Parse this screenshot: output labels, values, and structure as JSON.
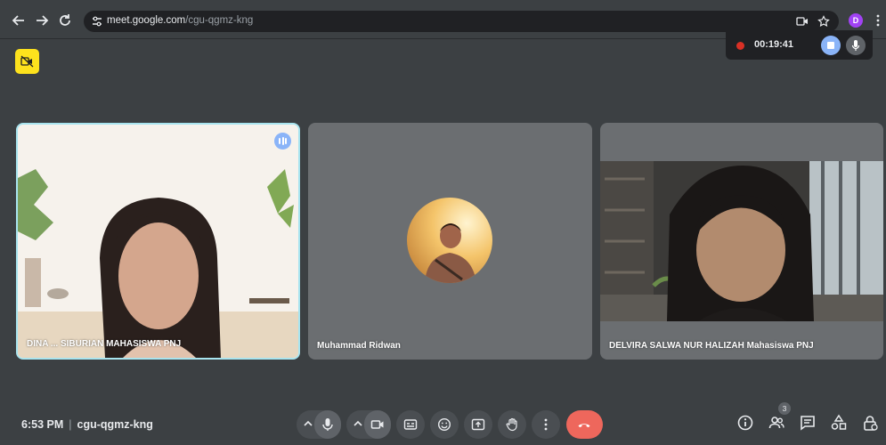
{
  "browser": {
    "url_host": "meet.google.com",
    "url_path": "/cgu-qgmz-kng",
    "profile_initial": "D"
  },
  "recorder": {
    "elapsed": "00:19:41"
  },
  "participants": [
    {
      "name": "DINA ... SIBURIAN MAHASISWA PNJ",
      "speaking": true
    },
    {
      "name": "Muhammad Ridwan",
      "camera": "off"
    },
    {
      "name": "DELVIRA SALWA NUR HALIZAH Mahasiswa PNJ",
      "camera": "on"
    }
  ],
  "bottom_bar": {
    "time": "6:53 PM",
    "meeting_code": "cgu-qgmz-kng",
    "people_count": "3"
  },
  "colors": {
    "background": "#3c4043",
    "tile": "#6b6e71",
    "end_call": "#ee675c",
    "speaking_ring": "#a8e4ef",
    "accent": "#8ab4f8",
    "yellow_badge": "#fde21d"
  },
  "icons": {
    "controls": [
      "mic-icon",
      "camera-icon",
      "captions-icon",
      "emoji-icon",
      "present-icon",
      "hand-icon",
      "more-icon",
      "end-call-icon"
    ],
    "side": [
      "info-icon",
      "people-icon",
      "chat-icon",
      "activities-icon",
      "host-controls-icon"
    ]
  }
}
